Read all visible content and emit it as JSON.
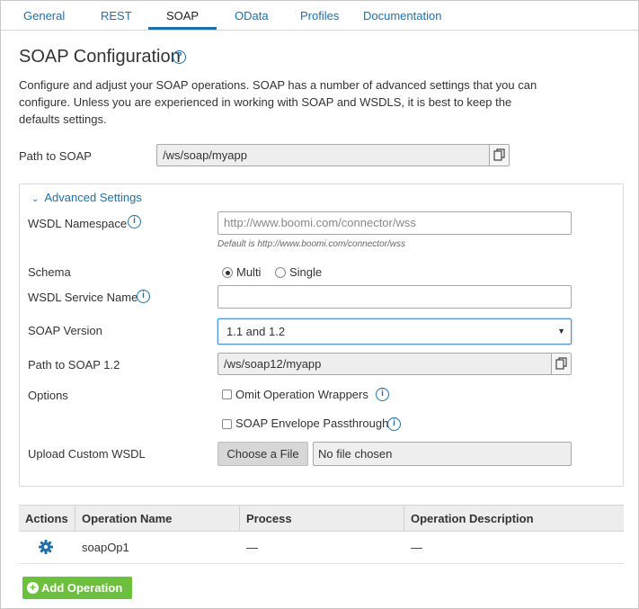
{
  "tabs": [
    {
      "label": "General"
    },
    {
      "label": "REST"
    },
    {
      "label": "SOAP"
    },
    {
      "label": "OData"
    },
    {
      "label": "Profiles"
    },
    {
      "label": "Documentation"
    }
  ],
  "active_tab": "SOAP",
  "page": {
    "title": "SOAP Configuration",
    "description": "Configure and adjust your SOAP operations. SOAP has a number of advanced settings that you can configure. Unless you are experienced in working with SOAP and WSDLS, it is best to keep the defaults settings."
  },
  "path_to_soap": {
    "label": "Path to SOAP",
    "value": "/ws/soap/myapp"
  },
  "advanced": {
    "title": "Advanced Settings",
    "wsdl_namespace": {
      "label": "WSDL Namespace",
      "placeholder": "http://www.boomi.com/connector/wss",
      "hint": "Default is http://www.boomi.com/connector/wss"
    },
    "schema": {
      "label": "Schema",
      "options": [
        "Multi",
        "Single"
      ],
      "selected": "Multi"
    },
    "wsdl_service_name": {
      "label": "WSDL Service Name",
      "value": ""
    },
    "soap_version": {
      "label": "SOAP Version",
      "value": "1.1 and 1.2"
    },
    "path_to_soap12": {
      "label": "Path to SOAP 1.2",
      "value": "/ws/soap12/myapp"
    },
    "options": {
      "label": "Options",
      "omit_wrappers": {
        "label": "Omit Operation Wrappers",
        "checked": false
      },
      "envelope_passthrough": {
        "label": "SOAP Envelope Passthrough",
        "checked": false
      }
    },
    "upload": {
      "label": "Upload Custom WSDL",
      "button": "Choose a File",
      "file_text": "No file chosen"
    }
  },
  "table": {
    "headers": [
      "Actions",
      "Operation Name",
      "Process",
      "Operation Description"
    ],
    "rows": [
      {
        "name": "soapOp1",
        "process": "—",
        "description": "—"
      }
    ]
  },
  "add_button": "Add Operation",
  "colors": {
    "accent": "#1f6fa8",
    "add_button": "#6cbf3f"
  }
}
